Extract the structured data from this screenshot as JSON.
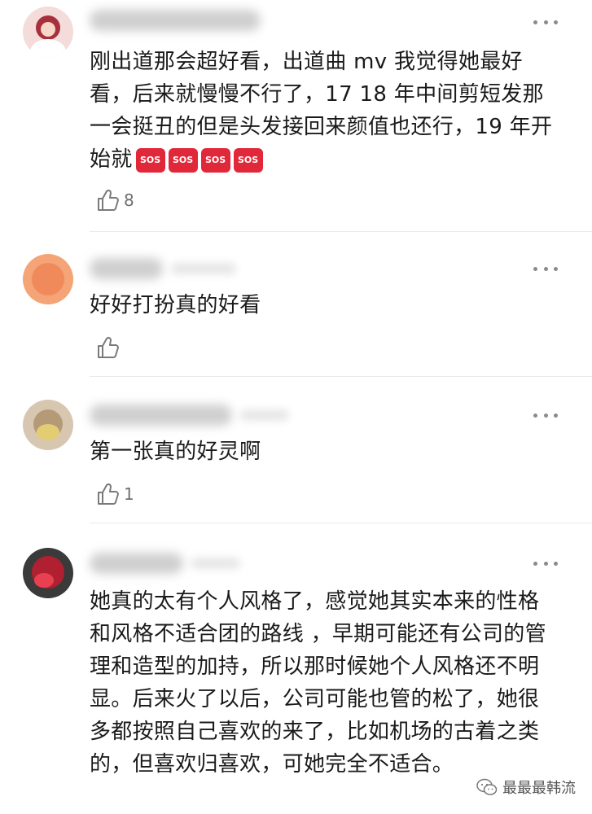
{
  "comments": [
    {
      "text": "刚出道那会超好看，出道曲 mv 我觉得她最好看，后来就慢慢不行了，17 18 年中间剪短发那一会挺丑的但是头发接回来颜值也还行，19 年开始就",
      "emoji": [
        "SOS",
        "SOS",
        "SOS",
        "SOS"
      ],
      "likes": "8",
      "avatar_color": "#b03a48"
    },
    {
      "text": "好好打扮真的好看",
      "likes": "",
      "avatar_color": "#f09060"
    },
    {
      "text": "第一张真的好灵啊",
      "likes": "1",
      "avatar_color": "#c2a88a"
    },
    {
      "text": "她真的太有个人风格了，感觉她其实本来的性格和风格不适合团的路线 ，早期可能还有公司的管理和造型的加持，所以那时候她个人风格还不明显。后来火了以后，公司可能也管的松了，她很多都按照自己喜欢的来了，比如机场的古着之类的，但喜欢归喜欢，可她完全不适合。",
      "avatar_color": "#b02030"
    }
  ],
  "watermark": "最最最韩流"
}
